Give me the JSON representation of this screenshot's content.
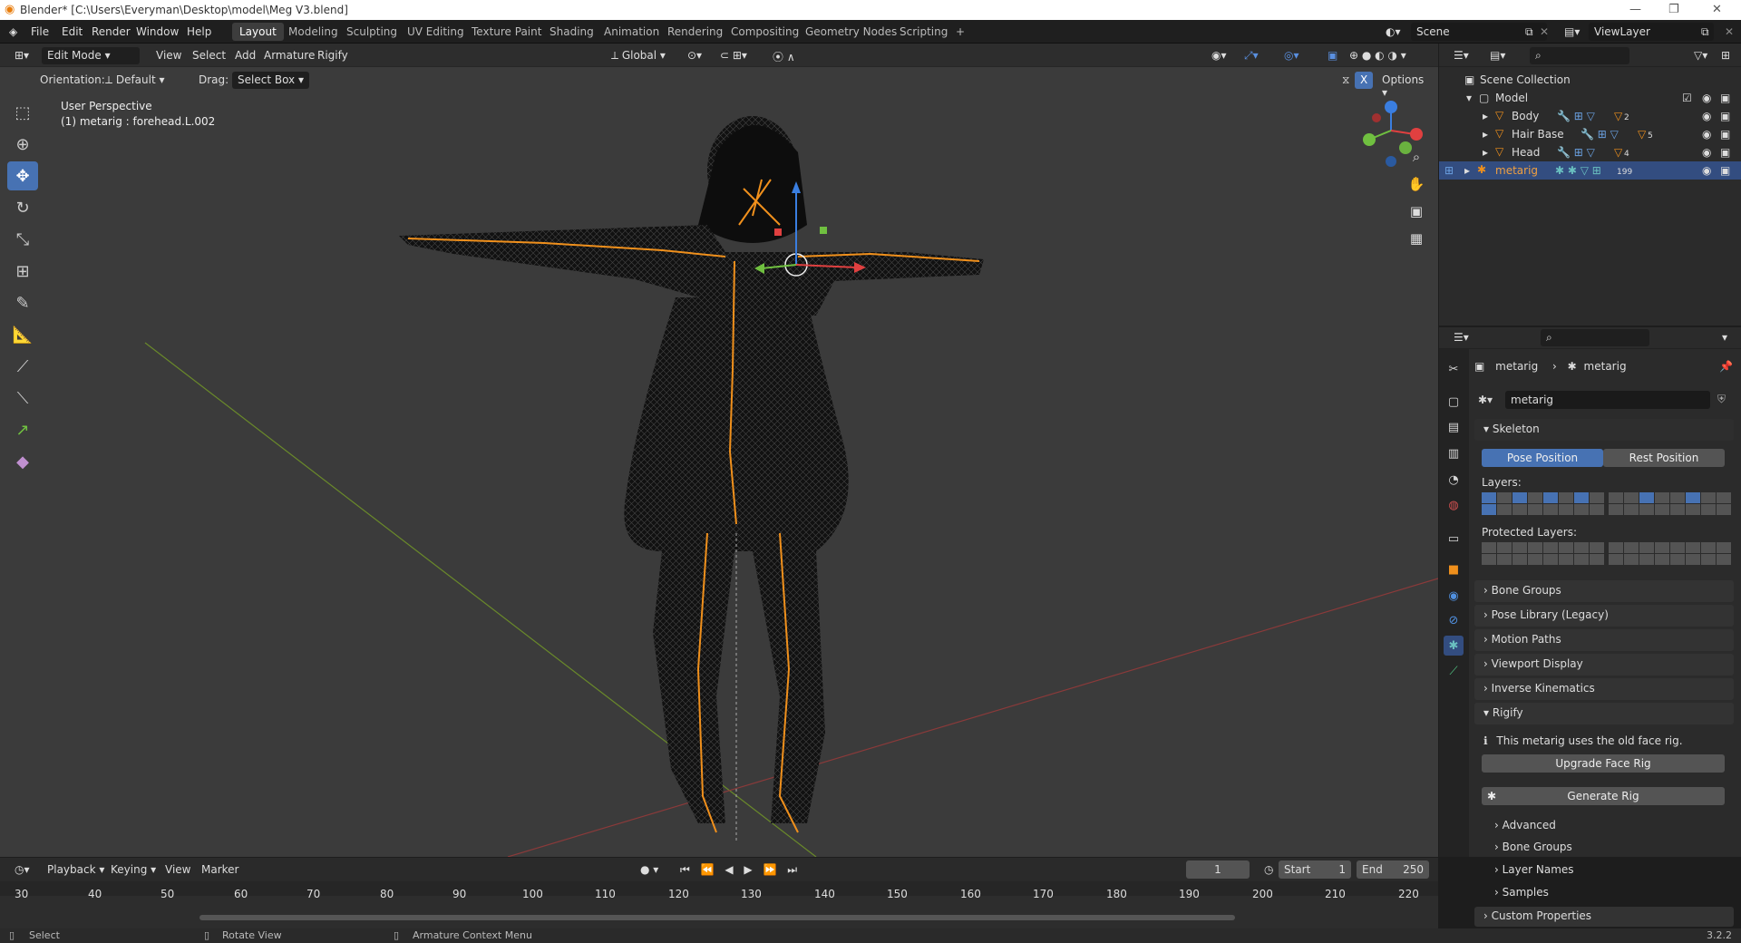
{
  "title_bar": {
    "text": "Blender* [C:\\Users\\Everyman\\Desktop\\model\\Meg V3.blend]"
  },
  "menus": [
    "File",
    "Edit",
    "Render",
    "Window",
    "Help"
  ],
  "workspaces": [
    "Layout",
    "Modeling",
    "Sculpting",
    "UV Editing",
    "Texture Paint",
    "Shading",
    "Animation",
    "Rendering",
    "Compositing",
    "Geometry Nodes",
    "Scripting",
    "+"
  ],
  "scene": "Scene",
  "view_layer": "ViewLayer",
  "viewport": {
    "mode": "Edit Mode",
    "menus": [
      "View",
      "Select",
      "Add",
      "Armature",
      "Rigify"
    ],
    "transform": "Global",
    "orientation_label": "Orientation:",
    "orientation_value": "Default",
    "drag_label": "Drag:",
    "drag_value": "Select Box",
    "options": "Options",
    "overlay_line1": "User Perspective",
    "overlay_line2": "(1) metarig : forehead.L.002",
    "x_toggle": "X"
  },
  "outliner": {
    "collection": "Scene Collection",
    "items": [
      {
        "label": "Model",
        "count": ""
      },
      {
        "label": "Body",
        "count": "2"
      },
      {
        "label": "Hair Base",
        "count": "5"
      },
      {
        "label": "Head",
        "count": "4"
      },
      {
        "label": "metarig",
        "count": "199"
      }
    ]
  },
  "properties": {
    "breadcrumb_a": "metarig",
    "breadcrumb_b": "metarig",
    "datablock": "metarig",
    "skeleton": "Skeleton",
    "pose_position": "Pose Position",
    "rest_position": "Rest Position",
    "layers": "Layers:",
    "protected_layers": "Protected Layers:",
    "panels": [
      "Bone Groups",
      "Pose Library (Legacy)",
      "Motion Paths",
      "Viewport Display",
      "Inverse Kinematics"
    ],
    "rigify": "Rigify",
    "rigify_note": "This metarig uses the old face rig.",
    "upgrade": "Upgrade Face Rig",
    "generate": "Generate Rig",
    "rigify_sub": [
      "Advanced",
      "Bone Groups",
      "Layer Names",
      "Samples"
    ],
    "custom_properties": "Custom Properties"
  },
  "timeline": {
    "menus": [
      "Playback",
      "Keying",
      "View",
      "Marker"
    ],
    "current": "1",
    "start_label": "Start",
    "start": "1",
    "end_label": "End",
    "end": "250",
    "ticks": [
      "30",
      "40",
      "50",
      "60",
      "70",
      "80",
      "90",
      "100",
      "110",
      "120",
      "130",
      "140",
      "150",
      "160",
      "170",
      "180",
      "190",
      "200",
      "210",
      "220"
    ]
  },
  "status": {
    "items": [
      "Select",
      "Rotate View",
      "Armature Context Menu"
    ],
    "version": "3.2.2"
  },
  "colors": {
    "accent": "#4772b3",
    "bone": "#f0901c",
    "selected_row": "#334d80"
  }
}
